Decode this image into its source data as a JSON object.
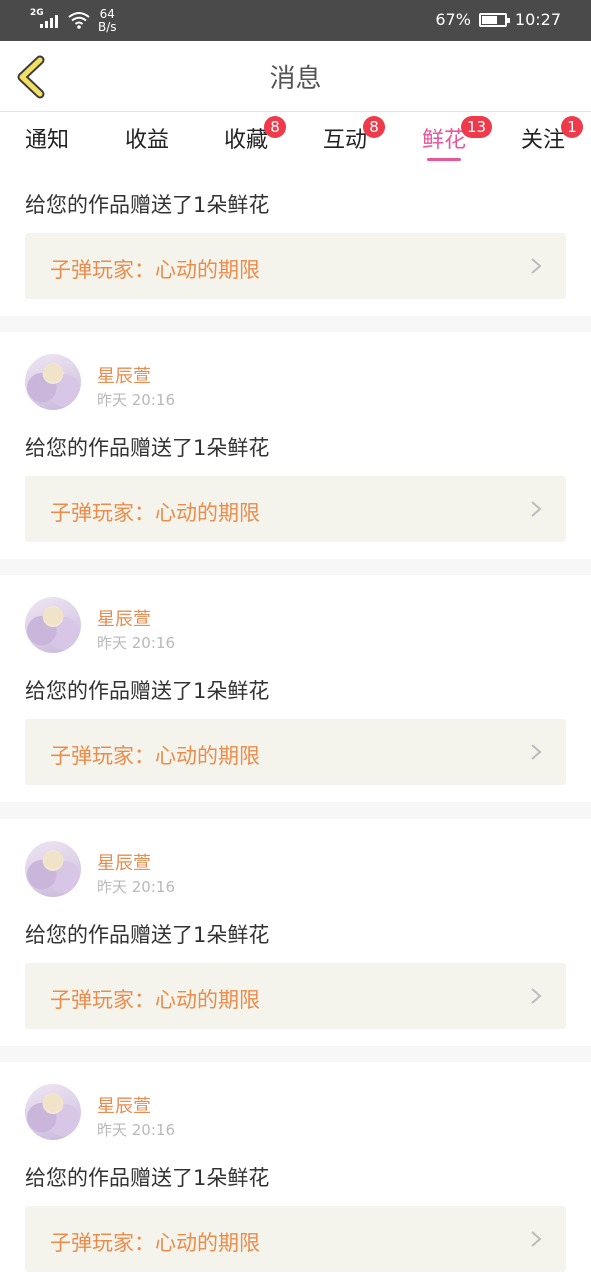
{
  "status_bar": {
    "network": "2G",
    "speed_value": "64",
    "speed_unit": "B/s",
    "battery_percent": "67%",
    "battery_level": 0.67,
    "time": "10:27"
  },
  "header": {
    "title": "消息",
    "back_icon": "chevron-left-icon"
  },
  "tabs": [
    {
      "label": "通知",
      "badge": ""
    },
    {
      "label": "收益",
      "badge": ""
    },
    {
      "label": "收藏",
      "badge": "8"
    },
    {
      "label": "互动",
      "badge": "8"
    },
    {
      "label": "鲜花",
      "badge": "13",
      "active": true
    },
    {
      "label": "关注",
      "badge": "1"
    }
  ],
  "colors": {
    "accent": "#e7589a",
    "badge": "#ee3a4a",
    "name": "#e88c50",
    "work_title": "#ea8d4c",
    "work_bg": "#f4f4ec"
  },
  "messages": [
    {
      "user": "",
      "time": "",
      "text": "给您的作品赠送了1朵鲜花",
      "work": "子弹玩家：心动的期限"
    },
    {
      "user": "星辰萱",
      "time": "昨天 20:16",
      "text": "给您的作品赠送了1朵鲜花",
      "work": "子弹玩家：心动的期限"
    },
    {
      "user": "星辰萱",
      "time": "昨天 20:16",
      "text": "给您的作品赠送了1朵鲜花",
      "work": "子弹玩家：心动的期限"
    },
    {
      "user": "星辰萱",
      "time": "昨天 20:16",
      "text": "给您的作品赠送了1朵鲜花",
      "work": "子弹玩家：心动的期限"
    },
    {
      "user": "星辰萱",
      "time": "昨天 20:16",
      "text": "给您的作品赠送了1朵鲜花",
      "work": "子弹玩家：心动的期限"
    }
  ]
}
